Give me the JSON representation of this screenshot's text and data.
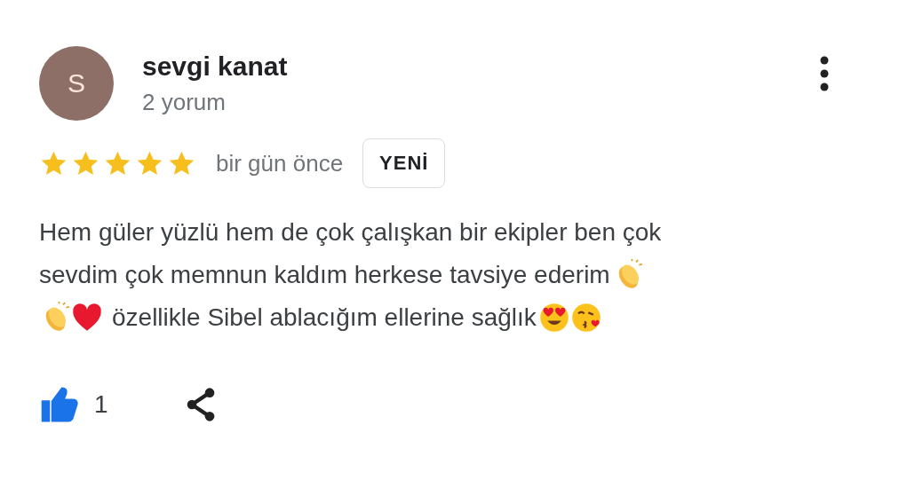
{
  "review": {
    "avatar_letter": "S",
    "author": "sevgi kanat",
    "review_count": "2 yorum",
    "stars": 5,
    "time": "bir gün önce",
    "badge": "YENİ",
    "text_lines": [
      [
        {
          "kind": "text",
          "text": "Hem güler yüzlü hem de çok çalışkan bir ekipler ben çok"
        }
      ],
      [
        {
          "kind": "text",
          "text": "sevdim çok memnun kaldım herkese tavsiye ederim"
        },
        {
          "kind": "clap"
        }
      ],
      [
        {
          "kind": "clap"
        },
        {
          "kind": "heart"
        },
        {
          "kind": "text",
          "text": "özellikle Sibel ablacığım ellerine sağlık"
        },
        {
          "kind": "heart-eyes"
        },
        {
          "kind": "kiss"
        }
      ]
    ],
    "likes": {
      "count": "1",
      "liked": true
    }
  }
}
